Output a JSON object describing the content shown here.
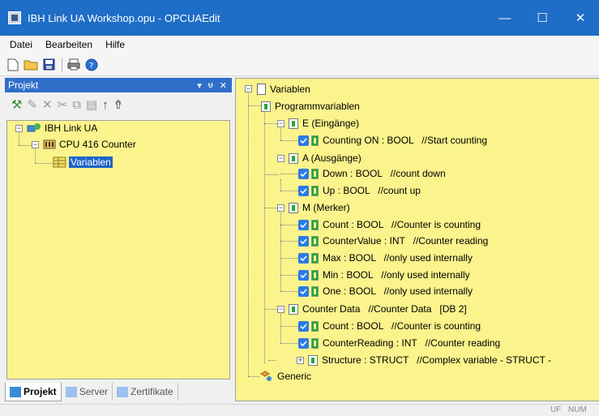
{
  "window": {
    "title": "IBH Link UA Workshop.opu - OPCUAEdit",
    "minimize": "—",
    "maximize": "☐",
    "close": "✕"
  },
  "menu": [
    "Datei",
    "Bearbeiten",
    "Hilfe"
  ],
  "toolbar_icons": [
    "new-file-icon",
    "open-folder-icon",
    "save-icon",
    "print-icon",
    "help-icon"
  ],
  "left_pane": {
    "title": "Projekt",
    "header_buttons": [
      "▾",
      "ᵾ",
      "✕"
    ],
    "tree": {
      "root": "IBH Link UA",
      "cpu": "CPU 416 Counter",
      "vars": "Variablen"
    },
    "tabs": [
      "Projekt",
      "Server",
      "Zertifikate"
    ]
  },
  "right_pane": {
    "root": "Variablen",
    "programm": "Programmvariablen",
    "group_e": "E (Eingänge)",
    "e_items": [
      "Counting ON : BOOL   //Start counting"
    ],
    "group_a": "A (Ausgänge)",
    "a_items": [
      "Down : BOOL   //count down",
      "Up : BOOL   //count up"
    ],
    "group_m": "M (Merker)",
    "m_items": [
      "Count : BOOL   //Counter is counting",
      "CounterValue : INT   //Counter reading",
      "Max : BOOL   //only used internally",
      "Min : BOOL   //only used internally",
      "One : BOOL   //only used internally"
    ],
    "group_db": "Counter Data   //Counter Data   [DB 2]",
    "db_items": [
      "Count : BOOL   //Counter is counting",
      "CounterReading : INT   //Counter reading"
    ],
    "struct": "Structure : STRUCT   //Complex variable - STRUCT -",
    "generic": "Generic"
  },
  "status": {
    "uf": "UF",
    "num": "NUM"
  },
  "colors": {
    "titlebar": "#1e6dc6",
    "tree_bg": "#fbf38c",
    "selection": "#1e64c8",
    "checkbox": "#2b7be4"
  }
}
